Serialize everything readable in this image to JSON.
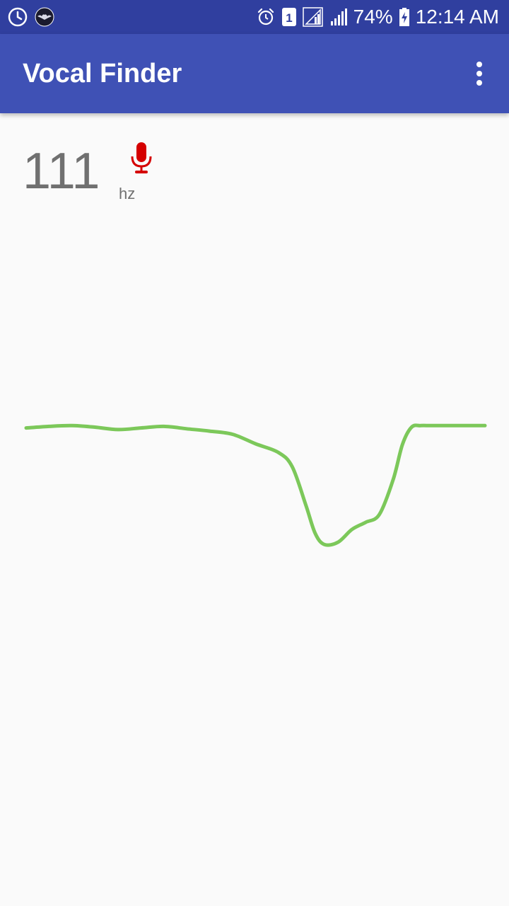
{
  "status_bar": {
    "battery_percent": "74%",
    "time": "12:14 AM",
    "sim_number": "1",
    "icons": [
      "clock-icon",
      "app-notification-icon",
      "alarm-icon",
      "sim-icon",
      "signal-icon",
      "signal-icon",
      "battery-charging-icon"
    ]
  },
  "app_bar": {
    "title": "Vocal Finder",
    "menu_icon": "more-vert-icon"
  },
  "reading": {
    "value": "111",
    "unit": "hz",
    "mic_icon": "microphone-icon"
  },
  "colors": {
    "status_bar": "#303f9f",
    "app_bar": "#3f51b5",
    "mic": "#d50000",
    "pitch_line": "#7cc85a",
    "text_gray": "#707070",
    "background": "#fafafa"
  },
  "chart_data": {
    "type": "line",
    "title": "",
    "xlabel": "",
    "ylabel": "",
    "grid": false,
    "legend": "none",
    "xlim": [
      0,
      100
    ],
    "ylim": [
      0,
      100
    ],
    "x": [
      0,
      5,
      10,
      15,
      20,
      25,
      30,
      35,
      40,
      45,
      50,
      55,
      58,
      61,
      63,
      65,
      68,
      71,
      74,
      77,
      80,
      82,
      84,
      86,
      88,
      91,
      94,
      97,
      100
    ],
    "y": [
      60.3,
      60.5,
      60.6,
      60.4,
      60.1,
      60.3,
      60.5,
      60.2,
      59.9,
      59.5,
      58.3,
      57.2,
      55.4,
      50.5,
      47.0,
      45.6,
      45.9,
      47.5,
      48.4,
      49.4,
      53.8,
      58.2,
      60.4,
      60.6,
      60.6,
      60.6,
      60.6,
      60.6,
      60.6
    ],
    "series": [
      {
        "values": []
      }
    ]
  }
}
